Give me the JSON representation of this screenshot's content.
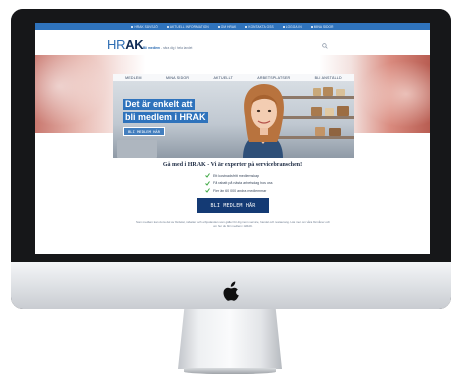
{
  "topbar": {
    "items": [
      "HRAK SÄVSJÖ",
      "AKTUELL INFORMATION",
      "OM HRAK",
      "KONTAKTA OSS",
      "LOGGA IN",
      "MINA SIDOR",
      "KONTAKTA HRAK"
    ]
  },
  "header": {
    "logo_hr": "HR",
    "logo_ak": "AK",
    "logo_sub_bold": "Bli medlem",
    "logo_sub_rest": " - nära dig i hela landet"
  },
  "nav": {
    "items": [
      "MEDLEM",
      "MINA SIDOR",
      "AKTUELLT",
      "ARBETSPLATSER",
      "BLI ANSTÄLLD"
    ]
  },
  "hero": {
    "title_line1": "Det är enkelt att",
    "title_line2": "bli medlem i HRAK",
    "cta": "BLI MEDLEM HÄR"
  },
  "main": {
    "headline": "Gå med i HRAK - Vi är experter på servicebranschen!",
    "checks": [
      "Ett kostnadsfritt medlemskap",
      "Få rabatt på nästa arbetsdag hos oss",
      "Fler än 60 000 andra medlemmar"
    ],
    "cta": "BLI MEDLEM HÄR",
    "footnote": "Som medlem kan du ta del av fördelar, rabatter och erbjudanden som gäller för dig inom service, handel och restaurang. Läs mer om våra förmåner och om hur du blir medlem i HRAK."
  },
  "colors": {
    "brand_blue": "#2f73bc",
    "brand_navy": "#143a74",
    "check_green": "#3aa63f"
  }
}
